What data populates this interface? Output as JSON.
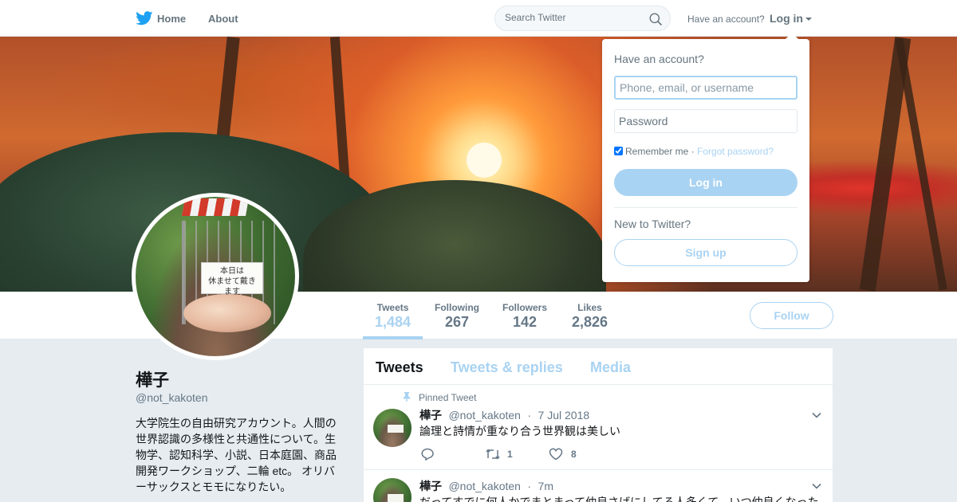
{
  "nav": {
    "home_label": "Home",
    "about_label": "About",
    "search_placeholder": "Search Twitter",
    "have_account": "Have an account?",
    "login_label": "Log in",
    "brand_color": "#1da1f2"
  },
  "profile": {
    "name": "樺子",
    "handle": "@not_kakoten",
    "bio": "大学院生の自由研究アカウント。人間の世界認識の多様性と共通性について。生物学、認知科学、小説、日本庭園、商品開発ワークショップ、二輪 etc。 オリバーサックスとモモになりたい。",
    "avatar_sign_line1": "本日は",
    "avatar_sign_line2": "休ませて戴きます"
  },
  "stats": [
    {
      "label": "Tweets",
      "value": "1,484"
    },
    {
      "label": "Following",
      "value": "267"
    },
    {
      "label": "Followers",
      "value": "142"
    },
    {
      "label": "Likes",
      "value": "2,826"
    }
  ],
  "follow_label": "Follow",
  "timeline": {
    "tabs": [
      "Tweets",
      "Tweets & replies",
      "Media"
    ],
    "tweets": [
      {
        "pinned_label": "Pinned Tweet",
        "name": "樺子",
        "handle": "@not_kakoten",
        "dot": "·",
        "time": "7 Jul 2018",
        "text": "論理と詩情が重なり合う世界観は美しい",
        "retweets": "1",
        "likes": "8"
      },
      {
        "name": "樺子",
        "handle": "@not_kakoten",
        "dot": "·",
        "time": "7m",
        "text": "だってすでに何人かでまとまって仲良さげにしてる人多くて、いつ仲良くなった"
      }
    ]
  },
  "login_dropdown": {
    "title": "Have an account?",
    "username_placeholder": "Phone, email, or username",
    "password_placeholder": "Password",
    "remember_label": "Remember me",
    "separator": " · ",
    "forgot_label": "Forgot password?",
    "login_button": "Log in",
    "new_label": "New to Twitter?",
    "signup_button": "Sign up"
  },
  "colors": {
    "accent_light": "#a9d3f2",
    "text_muted": "#657786",
    "background": "#e6ecf0"
  }
}
